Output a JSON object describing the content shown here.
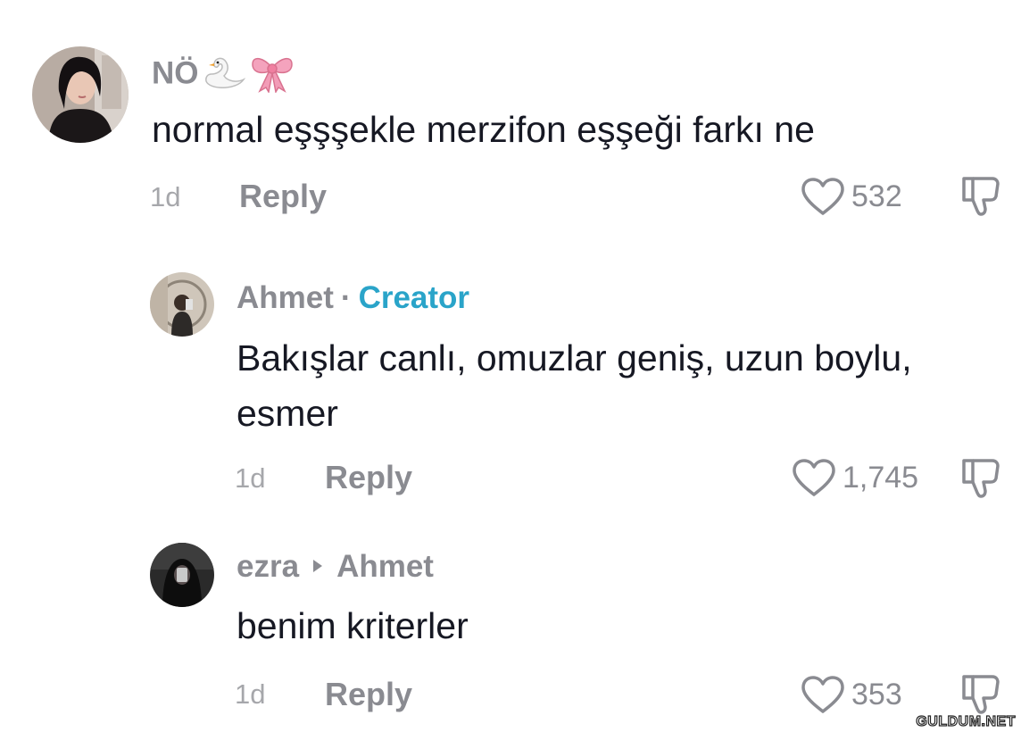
{
  "comments": [
    {
      "username": "NÖ",
      "text": "normal eşşşekle merzifon eşşeği farkı ne",
      "time": "1d",
      "reply_label": "Reply",
      "likes": "532"
    },
    {
      "username": "Ahmet",
      "separator": "·",
      "badge": "Creator",
      "text": "Bakışlar canlı, omuzlar geniş, uzun boylu, esmer",
      "time": "1d",
      "reply_label": "Reply",
      "likes": "1,745"
    },
    {
      "username": "ezra",
      "reply_to": "Ahmet",
      "text": "benim kriterler",
      "time": "1d",
      "reply_label": "Reply",
      "likes": "353"
    }
  ],
  "icons": {
    "emoji_1": "swan-emoji-icon",
    "emoji_2": "ribbon-emoji-icon",
    "like": "heart-outline-icon",
    "dislike": "thumbs-down-outline-icon",
    "reply_arrow": "triangle-right-icon"
  },
  "colors": {
    "creator_badge": "#2aa4c9",
    "secondary_text": "#8a8b91",
    "primary_text": "#161823"
  },
  "watermark": "GULDUM.NET"
}
